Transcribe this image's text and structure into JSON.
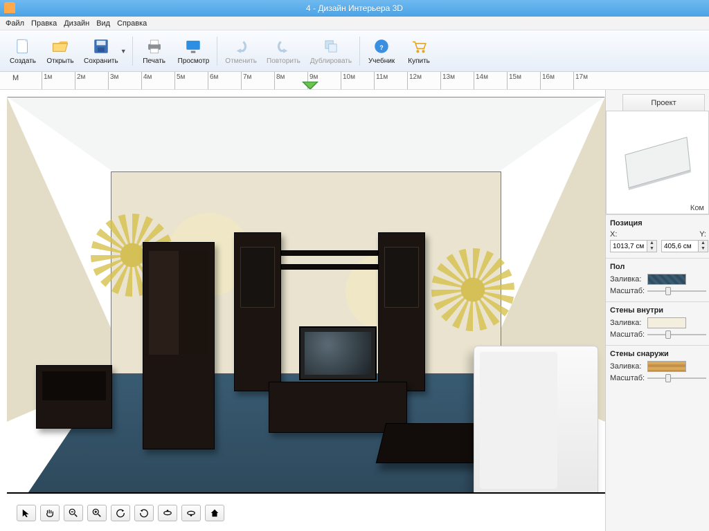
{
  "window": {
    "title": "4 - Дизайн Интерьера 3D"
  },
  "menu": {
    "file": "Файл",
    "edit": "Правка",
    "design": "Дизайн",
    "view": "Вид",
    "help": "Справка"
  },
  "toolbar": {
    "create": "Создать",
    "open": "Открыть",
    "save": "Сохранить",
    "print": "Печать",
    "preview": "Просмотр",
    "undo": "Отменить",
    "redo": "Повторить",
    "duplicate": "Дублировать",
    "tutorial": "Учебник",
    "buy": "Купить"
  },
  "ruler": {
    "unit": "М",
    "ticks": [
      "1м",
      "2м",
      "3м",
      "4м",
      "5м",
      "6м",
      "7м",
      "8м",
      "9м",
      "10м",
      "11м",
      "12м",
      "13м",
      "14м",
      "15м",
      "16м",
      "17м"
    ]
  },
  "sidepanel": {
    "tab": "Проект",
    "preview_label": "Ком",
    "groups": {
      "position": {
        "title": "Позиция",
        "x_label": "X:",
        "y_label": "Y:",
        "x": "1013,7 см",
        "y": "405,6 см"
      },
      "floor": {
        "title": "Пол",
        "fill_label": "Заливка:",
        "scale_label": "Масштаб:"
      },
      "walls_in": {
        "title": "Стены внутри",
        "fill_label": "Заливка:",
        "scale_label": "Масштаб:"
      },
      "walls_out": {
        "title": "Стены снаружи",
        "fill_label": "Заливка:",
        "scale_label": "Масштаб:"
      }
    }
  }
}
